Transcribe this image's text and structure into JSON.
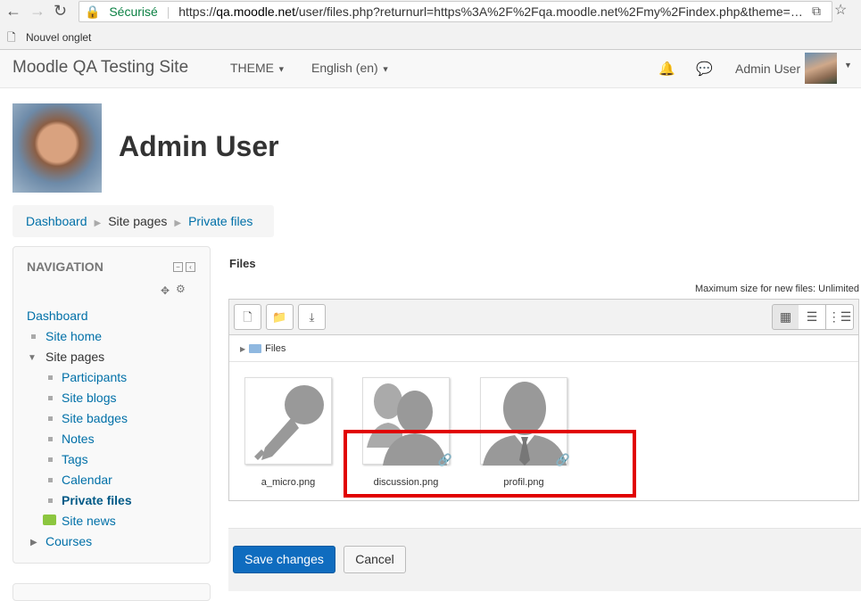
{
  "browser": {
    "secure_label": "Sécurisé",
    "url_scheme": "https://",
    "url_host": "qa.moodle.net",
    "url_path": "/user/files.php?returnurl=https%3A%2F%2Fqa.moodle.net%2Fmy%2Findex.php&theme=…",
    "bookmark": "Nouvel onglet"
  },
  "navbar": {
    "brand": "Moodle QA Testing Site",
    "theme_menu": "THEME",
    "lang_menu": "English (en)",
    "user_name": "Admin User"
  },
  "header": {
    "title": "Admin User"
  },
  "breadcrumb": [
    "Dashboard",
    "Site pages",
    "Private files"
  ],
  "navigation": {
    "title": "NAVIGATION",
    "dashboard": "Dashboard",
    "site_home": "Site home",
    "site_pages": "Site pages",
    "items": [
      "Participants",
      "Site blogs",
      "Site badges",
      "Notes",
      "Tags",
      "Calendar",
      "Private files"
    ],
    "site_news": "Site news",
    "courses": "Courses"
  },
  "files": {
    "section_label": "Files",
    "max_size": "Maximum size for new files: Unlimited",
    "path_root": "Files",
    "items": [
      {
        "name": "a_micro.png",
        "icon": "microphone-icon",
        "linked": false
      },
      {
        "name": "discussion.png",
        "icon": "users-group-icon",
        "linked": true
      },
      {
        "name": "profil.png",
        "icon": "user-profile-icon",
        "linked": true
      }
    ]
  },
  "actions": {
    "save": "Save changes",
    "cancel": "Cancel"
  },
  "colors": {
    "primary": "#0f6cbf",
    "link": "#0070a8",
    "highlight": "#e10000"
  }
}
